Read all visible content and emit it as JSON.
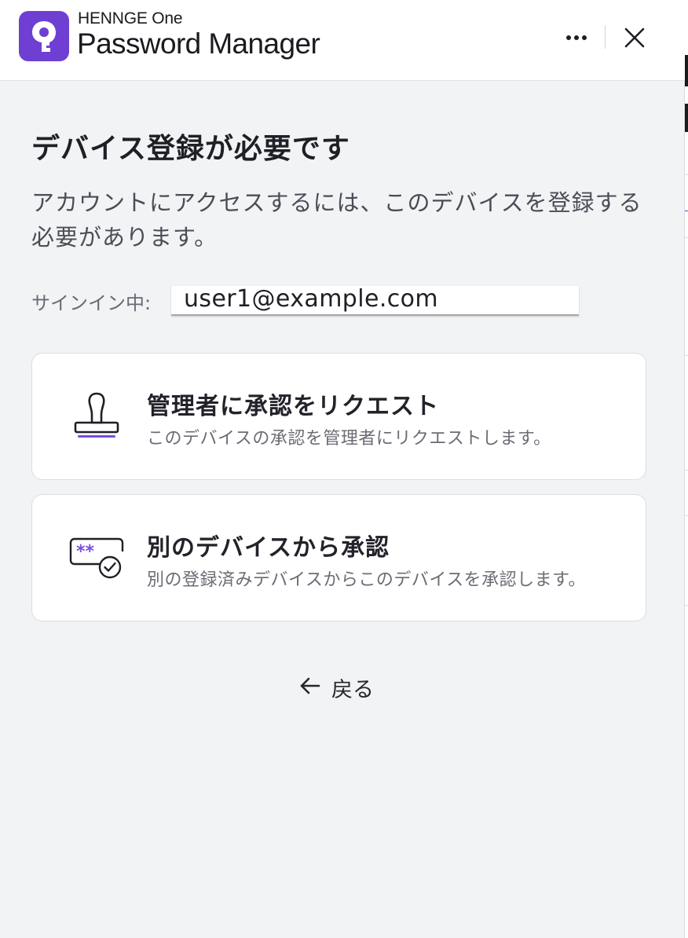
{
  "header": {
    "brand_top": "HENNGE One",
    "brand_name": "Password Manager",
    "menu_icon": "more-horizontal-icon",
    "close_icon": "close-icon",
    "accent_color": "#6f3fd3"
  },
  "main": {
    "title": "デバイス登録が必要です",
    "description": "アカウントにアクセスするには、このデバイスを登録する必要があります。",
    "signin_label": "サインイン中:",
    "signin_email": "user1@example.com"
  },
  "options": [
    {
      "icon": "stamp-icon",
      "title": "管理者に承認をリクエスト",
      "subtitle": "このデバイスの承認を管理者にリクエストします。"
    },
    {
      "icon": "password-check-icon",
      "title": "別のデバイスから承認",
      "subtitle": "別の登録済みデバイスからこのデバイスを承認します。"
    }
  ],
  "footer": {
    "back_icon": "arrow-left-icon",
    "back_label": "戻る"
  }
}
